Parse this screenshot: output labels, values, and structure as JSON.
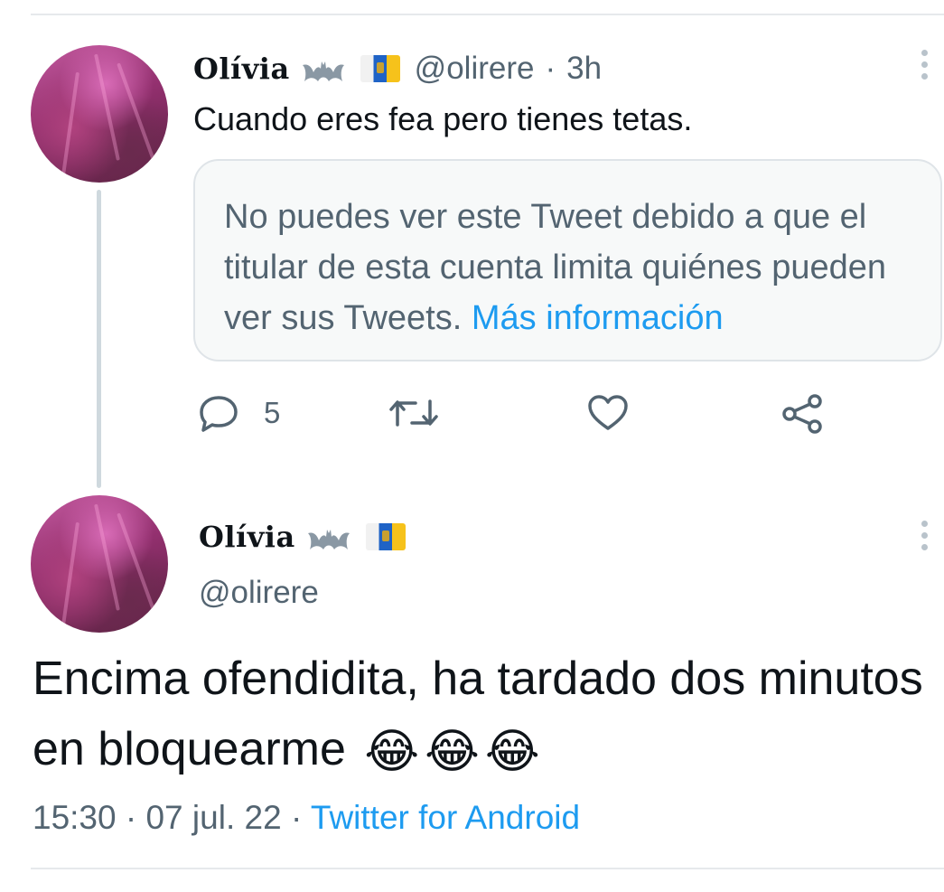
{
  "first_tweet": {
    "display_name": "Olívia",
    "handle": "@olirere",
    "time_sep": "·",
    "time": "3h",
    "text": "Cuando eres fea pero tienes tetas.",
    "notice": {
      "text": "No puedes ver este Tweet debido a que el titular de esta cuenta limita quiénes pueden ver sus Tweets.",
      "link": "Más información"
    },
    "actions": {
      "reply_count": "5"
    }
  },
  "main_tweet": {
    "display_name": "Olívia",
    "handle": "@olirere",
    "text": "Encima ofendidita, ha tardado dos minutos en bloquearme",
    "emojis": [
      "😂",
      "😂",
      "😂"
    ],
    "time": "15:30",
    "sep1": "·",
    "date": "07 jul. 22",
    "sep2": "·",
    "source": "Twitter for Android"
  },
  "colors": {
    "link": "#1d9bf0",
    "muted": "#536471",
    "divider": "#e6e9ec",
    "thread_line": "#cfd9de"
  },
  "icons": {
    "name_emoji": "bat-icon",
    "flag": "canary-islands-flag-icon",
    "reply": "reply-icon",
    "retweet": "retweet-icon",
    "like": "heart-icon",
    "share": "share-icon",
    "more": "more-vertical-icon"
  }
}
